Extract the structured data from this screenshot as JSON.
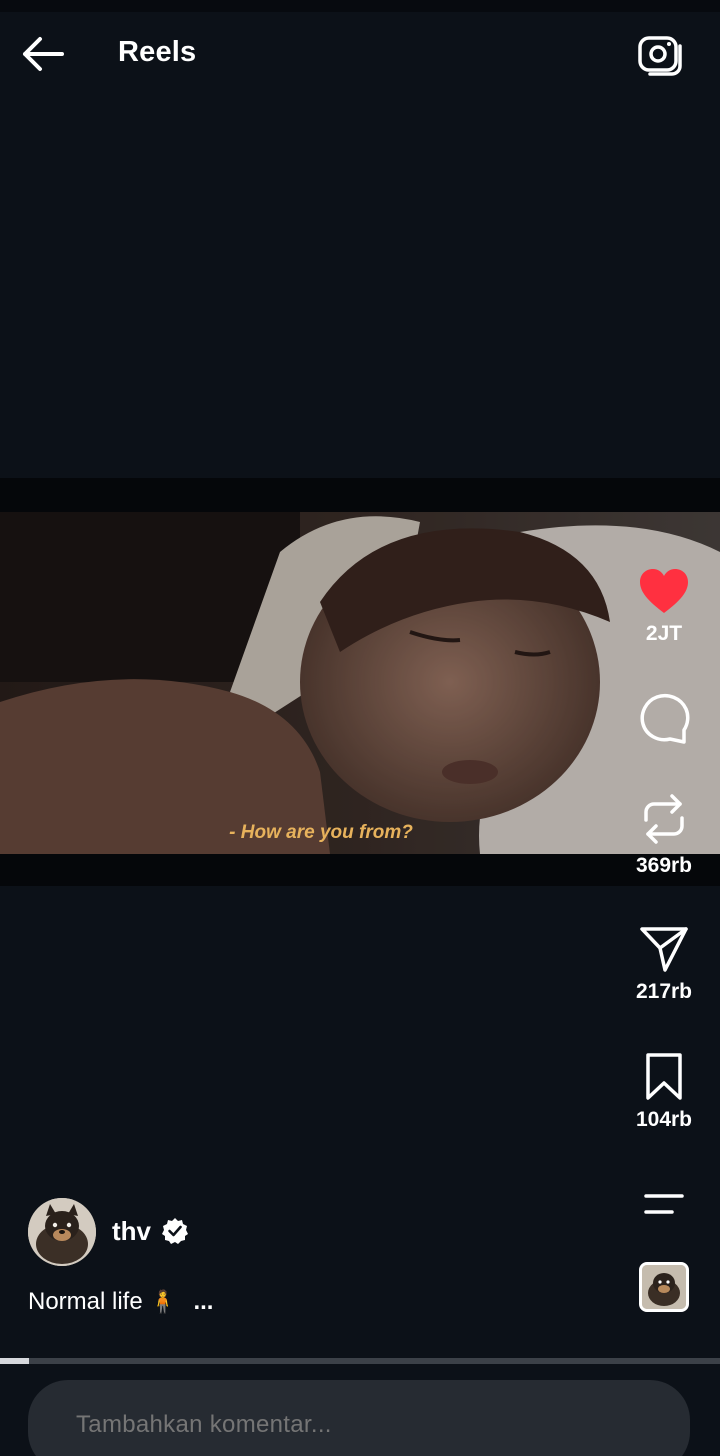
{
  "header": {
    "title": "Reels",
    "back_icon": "arrow-left-icon",
    "camera_icon": "camera-icon"
  },
  "video": {
    "subtitle": "- How are you from?"
  },
  "actions": {
    "like": {
      "icon": "heart-filled-icon",
      "count": "2JT",
      "color": "#ff3040"
    },
    "comment": {
      "icon": "comment-bubble-icon",
      "count": ""
    },
    "repost": {
      "icon": "repost-icon",
      "count": "369rb"
    },
    "share": {
      "icon": "send-icon",
      "count": "217rb"
    },
    "save": {
      "icon": "bookmark-icon",
      "count": "104rb"
    },
    "more": {
      "icon": "menu-lines-icon"
    }
  },
  "author": {
    "username": "thv",
    "verified": true
  },
  "caption": {
    "text": "Normal life",
    "emoji": "🧍",
    "more": "..."
  },
  "progress": {
    "fraction": 0.04
  },
  "comment_box": {
    "placeholder": "Tambahkan komentar..."
  }
}
